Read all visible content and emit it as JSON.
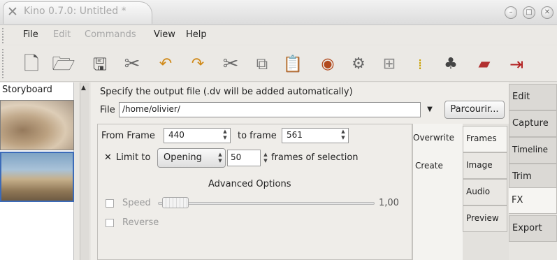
{
  "window": {
    "title": "Kino 0.7.0: Untitled *",
    "controls": [
      "minimize",
      "maximize",
      "close"
    ]
  },
  "menubar": {
    "items": [
      {
        "label": "File",
        "enabled": true
      },
      {
        "label": "Edit",
        "enabled": false
      },
      {
        "label": "Commands",
        "enabled": false
      },
      {
        "label": "View",
        "enabled": true
      },
      {
        "label": "Help",
        "enabled": true
      }
    ]
  },
  "toolbar": {
    "icons": [
      "new-file-icon",
      "open-folder-icon",
      "save-icon",
      "preferences-icon",
      "undo-icon",
      "redo-icon",
      "cut-icon",
      "copy-icon",
      "paste-icon",
      "capture-icon",
      "effects-icon",
      "split-icon",
      "join-icon",
      "publish-icon",
      "plugin-icon",
      "exit-icon"
    ]
  },
  "storyboard": {
    "label": "Storyboard"
  },
  "export": {
    "spec_label": "Specify the output file (.dv will be added automatically)",
    "file_label": "File",
    "file_value": "/home/olivier/",
    "browse_label": "Parcourir...",
    "from_label": "From Frame",
    "from_value": "440",
    "to_label": "to frame",
    "to_value": "561",
    "limit_check": "✕",
    "limit_label": "Limit to",
    "limit_mode": "Opening",
    "limit_value": "50",
    "limit_after": "frames of selection",
    "advanced_label": "Advanced Options",
    "speed_label": "Speed",
    "speed_value": "1,00",
    "reverse_label": "Reverse"
  },
  "inner_tabs": {
    "overwrite": "Overwrite",
    "create": "Create",
    "frames": "Frames",
    "image": "Image",
    "audio": "Audio",
    "preview": "Preview"
  },
  "side_tabs": {
    "edit": "Edit",
    "capture": "Capture",
    "timeline": "Timeline",
    "trim": "Trim",
    "fx": "FX",
    "export": "Export"
  }
}
